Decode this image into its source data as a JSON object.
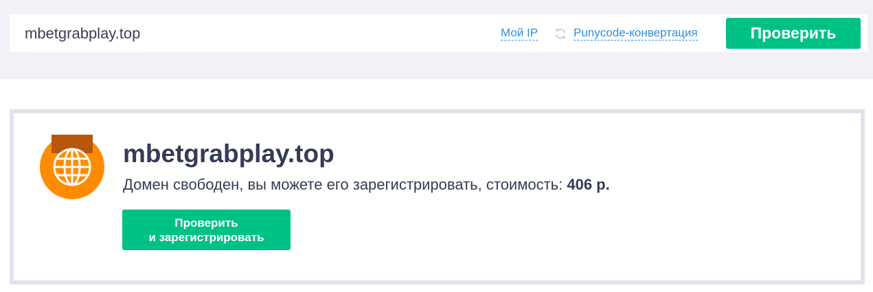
{
  "search": {
    "value": "mbetgrabplay.top",
    "my_ip_label": "Мой IP",
    "punycode_label": "Punycode-конвертация",
    "check_button": "Проверить",
    "refresh_icon": "refresh-icon"
  },
  "result": {
    "domain": "mbetgrabplay.top",
    "status_text": "Домен свободен, вы можете его зарегистрировать, стоимость: ",
    "price": "406 р.",
    "register_button_line1": "Проверить",
    "register_button_line2": "и зарегистрировать",
    "icon": "globe-icon"
  },
  "colors": {
    "accent": "#00c185",
    "link": "#2f8fe0",
    "icon_orange": "#ff8c00",
    "text_dark": "#333c54"
  }
}
